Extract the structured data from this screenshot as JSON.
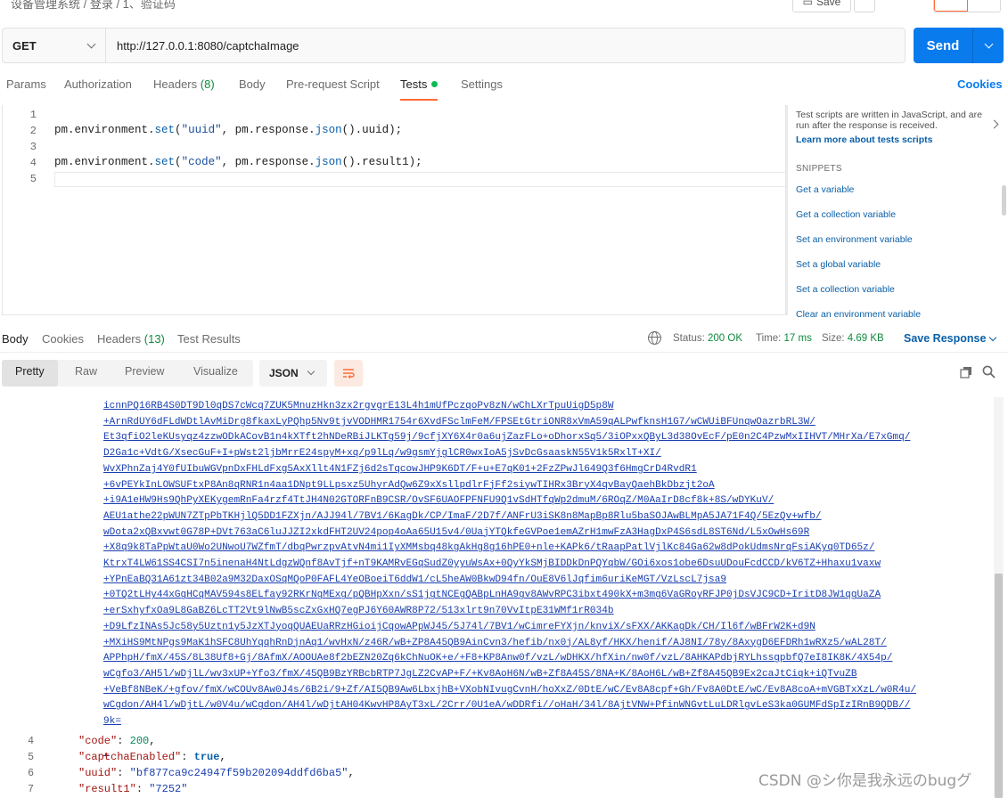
{
  "breadcrumb": "设备管理系统 / 登录 / 1、验证码",
  "toolbar": {
    "save_label": "Save"
  },
  "request": {
    "method": "GET",
    "url": "http://127.0.0.1:8080/captchaImage",
    "send_label": "Send"
  },
  "request_tabs": {
    "params": "Params",
    "authorization": "Authorization",
    "headers": "Headers",
    "headers_count": "(8)",
    "body": "Body",
    "prerequest": "Pre-request Script",
    "tests": "Tests",
    "settings": "Settings",
    "cookies": "Cookies"
  },
  "editor": {
    "lines": [
      "1",
      "2",
      "3",
      "4",
      "5"
    ],
    "line2": {
      "obj": "pm.environment.",
      "fn": "set",
      "a": "(",
      "s": "\"uuid\"",
      "b": ", pm.response.",
      "fn2": "json",
      "c": "().uuid);"
    },
    "line4": {
      "obj": "pm.environment.",
      "fn": "set",
      "a": "(",
      "s": "\"code\"",
      "b": ", pm.response.",
      "fn2": "json",
      "c": "().result1);"
    }
  },
  "snippets": {
    "description": "Test scripts are written in JavaScript, and are run after the response is received.",
    "learn_more": "Learn more about tests scripts",
    "heading": "SNIPPETS",
    "items": [
      "Get a variable",
      "Get a collection variable",
      "Set an environment variable",
      "Set a global variable",
      "Set a collection variable",
      "Clear an environment variable"
    ]
  },
  "response_tabs": {
    "body": "Body",
    "cookies": "Cookies",
    "headers": "Headers",
    "headers_count": "(13)",
    "test_results": "Test Results"
  },
  "response_meta": {
    "status_label": "Status:",
    "status_value": "200 OK",
    "time_label": "Time:",
    "time_value": "17 ms",
    "size_label": "Size:",
    "size_value": "4.69 KB",
    "save_response": "Save Response"
  },
  "format_bar": {
    "pretty": "Pretty",
    "raw": "Raw",
    "preview": "Preview",
    "visualize": "Visualize",
    "format": "JSON"
  },
  "response_body": {
    "img_lines": [
      "icnnPQ16RB4S0DT9Dl0qDS7cWcq7ZUK5MnuzHkn3zx2rgvgrE13L4h1mUfPczqoPv8zN/wChLXrTpuUigD5p8W",
      "+ArnRdUY6dFLdWDtlAvMiDrg8fkaxLyPQhp5Nv9tjvVODHMR1754r6XvdFSclmFeM/FPSEtGtriONR8xVmA59qALPwfknsH1G7/wCWUiBFUnqwOazrbRL3W/",
      "Et3qfiO2leKUsyqz4zzwODkACovB1n4kXTft2hNDeRBiJLKTg59j/9cfjXY6X4r0a6ujZazFLo+oDhorxSq5/3iOPxxQByL3d38OvEcF/pE0n2C4PzwMxIIHVT/MHrXa/E7xGmq/",
      "D2Ga1c+VdtG/XsecGuF+I+pWst2ljbMrrE24spyM+xq/p9lLq/w9gsmYjglCR0wxIoA5jSvDcGsaaskN55V1k5RxlT+XI/",
      "WvXPhnZaj4Y0fUIbuWGVpnDxFHLdFxg5AxXllt4N1FZj6d2sTqcowJHP9K6DT/F+u+E7qK01+2FzZPwJl649Q3f6HmgCrD4RvdR1",
      "+6vPEYkInLOWSUFtxP8An8qRNR1n4aa1DNpt9LLpsxz5UhyrAdQw6Z9xXsllpdlrFjFf2siywTIHRx3BryX4qvBayQaehBkDbzjt2oA",
      "+i9A1eHW9Hs9QhPyXEKygemRnFa4rzf4TtJH4N02GTORFnB9CSR/OvSF6UAOFPFNFU9Q1vSdHTfqWp2dmuM/6ROqZ/M0AaIrD8cf8k+8S/wDYKuV/",
      "AEU1athe22pWUN7ZTpPbTKHjlQ5DD1FZXjn/AJJ94l/7BV1/6KagDk/CP/ImaF/2D7f/ANFrU3iSK8n8MapBp8Rlu5baSOJAwBLMpA5JA71F4Q/5EzQv+wfb/",
      "wDota2xQBxvwt0G78P+DVt763aC6luJJZI2xkdFHT2UV24pop4oAa65U15v4/0UajYTQkfeGVPoe1emAZrH1mwFzA3HagDxP4S6sdL8ST6Nd/L5xOwHs69R",
      "+X8q9k8TaPpWtaU0Wo2UNwoU7WZfmT/dbqPwrzpvAtvN4mi1IyXMMsbq48kgAkHg8g16hPE0+nle+KAPk6/tRaapPatlVjlKc84Ga62w8dPokUdmsNrqFsiAKyq0TD65z/",
      "KtrxT4LW61SS4CSI7n5inenaH4NtLdgzWQnf8AvTjf+nT9KAMRvEGqSudZ0yyuWsAx+0QyYkSMjBIDDkDnPQYqbW/GOi6xos1obe6DsuUDouFcdCCD/kV6TZ+Hhaxu1vaxw",
      "+YPnEaBQ31A61zt34B02a9M32DaxOSqMQoP0FAFL4YeOBoeiT6ddW1/cL5heAW0BkwD94fn/OuE8V6lJqfim6uriKeMGT/VzLscL7jsa9",
      "+0TQ2tLHy44xGgHCqMAV594s8ELfay92RKrNgMExg/pQBHpXxn/sS1jgtNCEgQABpLnHA9gv8AWvRPC3ibxt490kX+m3mg6VaGRoyRFJP0jDsVJC9CD+IritD8JW1qgUaZA",
      "+erSxhyfxOa9L8GaBZ6LcTT2Vt9lNwB5scZxGxHQ7egPJ6Y60AWR8P72/513xlrt9n70VvItpE31WMf1rR034b",
      "+D9LfzINAs5Jc58y5Uztn1y5JzXTJyoqQUAEUaRRzHGioijCqowAPpWJ45/5J74l/7BV1/wCimreFYXjn/knviX/sFXX/AKKagDk/CH/Il6f/wBFrW2K+d9N",
      "+MXiHS9MtNPgs9MaK1hSFC8UhYqqhRnDjnAq1/wvHxN/z46R/wB+ZP8A45QB9AinCvn3/hefib/nx0j/AL8yf/HKX/henif/AJ8NI/78y/8AxygD6EFDRh1wRXz5/wAL28T/",
      "APPhpH/fmX/45S/8L38Uf8+Gj/8AfmX/AOOUAe8f2bEZN20Zq6kChNuOK+e/+F8+KP8Anw0f/vzL/wDHKX/hfXin/nw0f/vzL/8AHKAPdbjRYLhssgpbfQ7eI8IK8K/4X54p/",
      "wCgfo3/AH5l/wDjlL/wv3xUP+Yfo3/fmX/45QB9BzYRBcbRTP7JgLZ2CvAP+F/+Kv8AoH6N/wB+Zf8A45S/8NA+K/8AoH6L/wB+Zf8A45QB9Ex2caJtCiqk+iQTvuZB",
      "+VeBf8NBeK/+gfov/fmX/wCOUv8Aw0J4s/6B2i/9+Zf/AI5QB9Aw6LbxjhB+VXobNIvugCvnH/hoXxZ/0DtE/wC/Ev8A8cpf+Gh/Fv8A0DtE/wC/Ev8A8coA+mVGBTxXzL/w0R4u/",
      "wCgdon/AH4l/wDjtL/w0V4u/wCgdon/AH4l/wDjtAH04KwvHP8AyT3xL/2Crr/0U1eA/wDDRfi//oHaH/34l/8AjtVNW+PfinWNGvtLuLDRlgvLeS3ka0GUMFdSpIzIRnB9QDB//",
      "9k="
    ],
    "img_tail": ",",
    "lines": [
      {
        "n": "4",
        "key": "\"code\"",
        "val": "200",
        "type": "num",
        "end": ","
      },
      {
        "n": "5",
        "key": "\"captchaEnabled\"",
        "val": "true",
        "type": "bool",
        "end": ","
      },
      {
        "n": "6",
        "key": "\"uuid\"",
        "val": "\"bf877ca9c24947f59b202094ddfd6ba5\"",
        "type": "str",
        "end": ","
      },
      {
        "n": "7",
        "key": "\"result1\"",
        "val": "\"7252\"",
        "type": "str",
        "end": ""
      }
    ]
  },
  "watermark": "CSDN @シ你是我永远のbugグ"
}
